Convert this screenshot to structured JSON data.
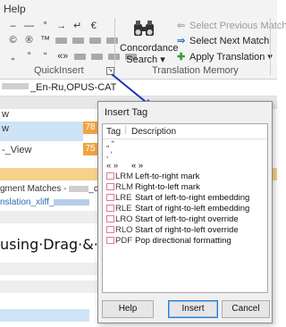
{
  "menu": {
    "help": "Help"
  },
  "quickinsert": {
    "row1": [
      "–",
      "—",
      "°",
      "→",
      "↵",
      "€"
    ],
    "row2": [
      "©",
      "®",
      "™"
    ],
    "row3": [
      "„",
      "”",
      "“",
      "«»"
    ],
    "group_label": "QuickInsert"
  },
  "concordance": {
    "label_line1": "Concordance",
    "label_line2": "Search ▾"
  },
  "tm": {
    "select_previous": "Select Previous Match",
    "select_next": "Select Next Match",
    "apply": "Apply Translation ▾",
    "group_label": "Translation Memory"
  },
  "document": {
    "tab_suffix": "_En-Ru,OPUS-CAT",
    "row_w": "w",
    "row_view": "-_View",
    "score1": "78",
    "score2": "75",
    "matches_prefix": "gment Matches - ",
    "matches_suffix": "_c..",
    "file_link": "nslation_xliff_",
    "big_text": "using·Drag·&·Drop"
  },
  "dialog": {
    "title": "Insert Tag",
    "col_tag": "Tag",
    "col_desc": "Description",
    "rows": [
      {
        "tag": "„ “",
        "desc": ""
      },
      {
        "tag": "‚ ‘",
        "desc": ""
      },
      {
        "tag": "« »",
        "desc": "« »"
      },
      {
        "tag": "LRM",
        "desc": "Left-to-right mark"
      },
      {
        "tag": "RLM",
        "desc": "Right-to-left mark"
      },
      {
        "tag": "LRE",
        "desc": "Start of left-to-right embedding"
      },
      {
        "tag": "RLE",
        "desc": "Start of right-to-left embedding"
      },
      {
        "tag": "LRO",
        "desc": "Start of left-to-right override"
      },
      {
        "tag": "RLO",
        "desc": "Start of right-to-left override"
      },
      {
        "tag": "PDF",
        "desc": "Pop directional formatting"
      }
    ],
    "btn_help": "Help",
    "btn_insert": "Insert",
    "btn_cancel": "Cancel"
  },
  "colors": {
    "accent": "#2a7ad3",
    "arrow": "#1f2fbf",
    "orange": "#f0a340",
    "highlight": "#cfe3f7"
  }
}
